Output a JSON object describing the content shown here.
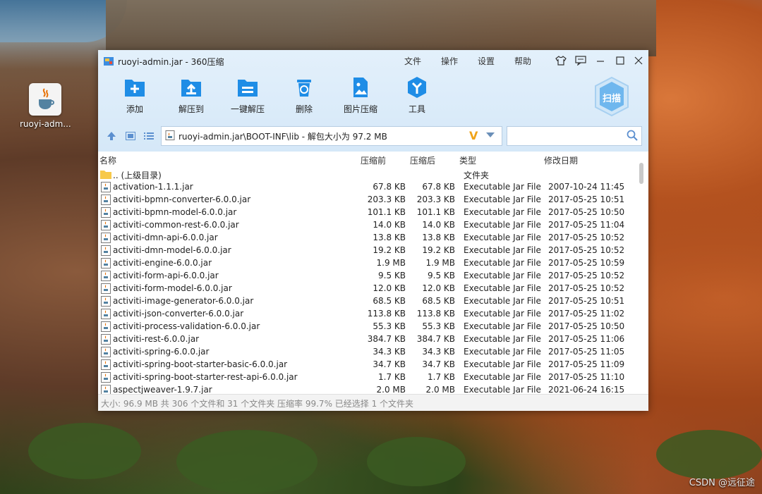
{
  "desktop": {
    "icon_label": "ruoyi-adm...",
    "watermark": "CSDN @远征途"
  },
  "window": {
    "title": "ruoyi-admin.jar - 360压缩",
    "menu": [
      "文件",
      "操作",
      "设置",
      "帮助"
    ],
    "toolbar": [
      {
        "label": "添加",
        "icon": "add-icon"
      },
      {
        "label": "解压到",
        "icon": "extract-to-icon"
      },
      {
        "label": "一键解压",
        "icon": "one-click-extract-icon"
      },
      {
        "label": "删除",
        "icon": "delete-icon"
      },
      {
        "label": "图片压缩",
        "icon": "image-compress-icon"
      },
      {
        "label": "工具",
        "icon": "tools-icon"
      }
    ],
    "scan_label": "扫描",
    "path": "ruoyi-admin.jar\\BOOT-INF\\lib - 解包大小为 97.2 MB",
    "search_placeholder": "",
    "columns": {
      "name": "名称",
      "before": "压缩前",
      "after": "压缩后",
      "type": "类型",
      "modified": "修改日期"
    },
    "parent_row": {
      "name": ".. (上级目录)",
      "type": "文件夹"
    },
    "files": [
      {
        "name": "activation-1.1.1.jar",
        "before": "67.8 KB",
        "after": "67.8 KB",
        "type": "Executable Jar File",
        "modified": "2007-10-24 11:45"
      },
      {
        "name": "activiti-bpmn-converter-6.0.0.jar",
        "before": "203.3 KB",
        "after": "203.3 KB",
        "type": "Executable Jar File",
        "modified": "2017-05-25 10:51"
      },
      {
        "name": "activiti-bpmn-model-6.0.0.jar",
        "before": "101.1 KB",
        "after": "101.1 KB",
        "type": "Executable Jar File",
        "modified": "2017-05-25 10:50"
      },
      {
        "name": "activiti-common-rest-6.0.0.jar",
        "before": "14.0 KB",
        "after": "14.0 KB",
        "type": "Executable Jar File",
        "modified": "2017-05-25 11:04"
      },
      {
        "name": "activiti-dmn-api-6.0.0.jar",
        "before": "13.8 KB",
        "after": "13.8 KB",
        "type": "Executable Jar File",
        "modified": "2017-05-25 10:52"
      },
      {
        "name": "activiti-dmn-model-6.0.0.jar",
        "before": "19.2 KB",
        "after": "19.2 KB",
        "type": "Executable Jar File",
        "modified": "2017-05-25 10:52"
      },
      {
        "name": "activiti-engine-6.0.0.jar",
        "before": "1.9 MB",
        "after": "1.9 MB",
        "type": "Executable Jar File",
        "modified": "2017-05-25 10:59"
      },
      {
        "name": "activiti-form-api-6.0.0.jar",
        "before": "9.5 KB",
        "after": "9.5 KB",
        "type": "Executable Jar File",
        "modified": "2017-05-25 10:52"
      },
      {
        "name": "activiti-form-model-6.0.0.jar",
        "before": "12.0 KB",
        "after": "12.0 KB",
        "type": "Executable Jar File",
        "modified": "2017-05-25 10:52"
      },
      {
        "name": "activiti-image-generator-6.0.0.jar",
        "before": "68.5 KB",
        "after": "68.5 KB",
        "type": "Executable Jar File",
        "modified": "2017-05-25 10:51"
      },
      {
        "name": "activiti-json-converter-6.0.0.jar",
        "before": "113.8 KB",
        "after": "113.8 KB",
        "type": "Executable Jar File",
        "modified": "2017-05-25 11:02"
      },
      {
        "name": "activiti-process-validation-6.0.0.jar",
        "before": "55.3 KB",
        "after": "55.3 KB",
        "type": "Executable Jar File",
        "modified": "2017-05-25 10:50"
      },
      {
        "name": "activiti-rest-6.0.0.jar",
        "before": "384.7 KB",
        "after": "384.7 KB",
        "type": "Executable Jar File",
        "modified": "2017-05-25 11:06"
      },
      {
        "name": "activiti-spring-6.0.0.jar",
        "before": "34.3 KB",
        "after": "34.3 KB",
        "type": "Executable Jar File",
        "modified": "2017-05-25 11:05"
      },
      {
        "name": "activiti-spring-boot-starter-basic-6.0.0.jar",
        "before": "34.7 KB",
        "after": "34.7 KB",
        "type": "Executable Jar File",
        "modified": "2017-05-25 11:09"
      },
      {
        "name": "activiti-spring-boot-starter-rest-api-6.0.0.jar",
        "before": "1.7 KB",
        "after": "1.7 KB",
        "type": "Executable Jar File",
        "modified": "2017-05-25 11:10"
      },
      {
        "name": "aspectjweaver-1.9.7.jar",
        "before": "2.0 MB",
        "after": "2.0 MB",
        "type": "Executable Jar File",
        "modified": "2021-06-24 16:15"
      }
    ],
    "status": "大小: 96.9 MB 共 306 个文件和 31 个文件夹 压缩率 99.7% 已经选择 1 个文件夹"
  }
}
